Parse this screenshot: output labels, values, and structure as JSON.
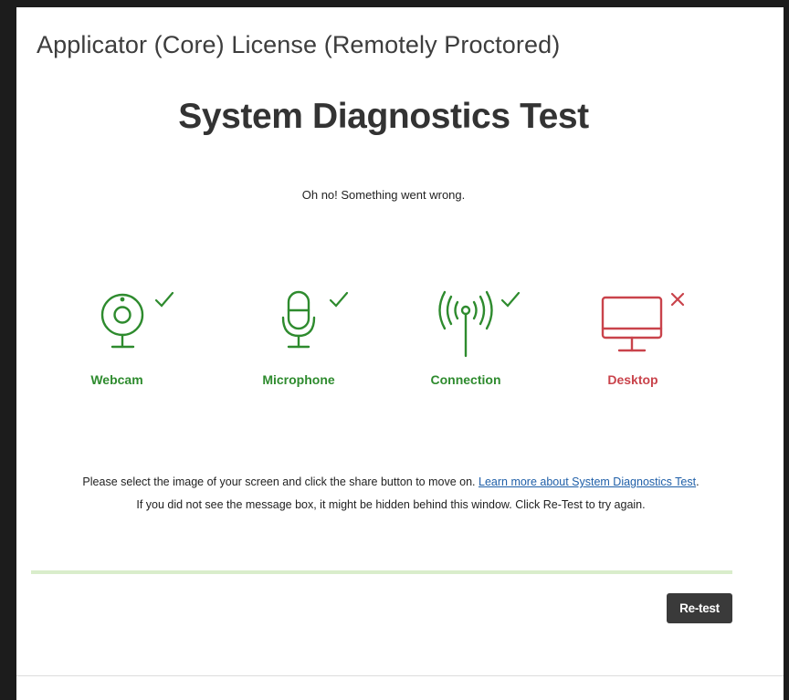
{
  "window": {
    "title": "Applicator (Core) License (Remotely Proctored)"
  },
  "page": {
    "heading": "System Diagnostics Test",
    "status_message": "Oh no! Something went wrong."
  },
  "diagnostics": [
    {
      "label": "Webcam",
      "status": "pass",
      "icon": "webcam-icon"
    },
    {
      "label": "Microphone",
      "status": "pass",
      "icon": "microphone-icon"
    },
    {
      "label": "Connection",
      "status": "pass",
      "icon": "antenna-icon"
    },
    {
      "label": "Desktop",
      "status": "fail",
      "icon": "monitor-icon"
    }
  ],
  "instructions": {
    "line1_text": "Please select the image of your screen and click the share button to move on. ",
    "learn_more_link": "Learn more about System Diagnostics Test",
    "line1_end": ".",
    "line2": "If you did not see the message box, it might be hidden behind this window. Click Re-Test to try again."
  },
  "progress": {
    "value": 1.0
  },
  "actions": {
    "retest_label": "Re-test"
  },
  "colors": {
    "pass": "#2e8b2e",
    "fail": "#c9434b",
    "link": "#1f5fa8",
    "button_bg": "#3a3a3a"
  }
}
